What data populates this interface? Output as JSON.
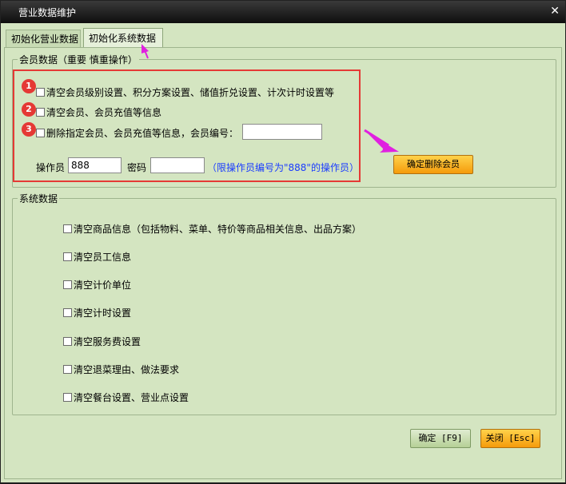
{
  "window": {
    "title": "营业数据维护"
  },
  "tabs": [
    {
      "label": "初始化营业数据"
    },
    {
      "label": "初始化系统数据"
    }
  ],
  "member_group": {
    "legend": "会员数据（重要  慎重操作）",
    "badges": [
      "1",
      "2",
      "3"
    ],
    "options": [
      {
        "label": "清空会员级别设置、积分方案设置、储值折兑设置、计次计时设置等"
      },
      {
        "label": "清空会员、会员充值等信息"
      },
      {
        "label": "删除指定会员、会员充值等信息，会员编号："
      }
    ],
    "member_no_value": "",
    "operator_label": "操作员",
    "operator_value": "888",
    "password_label": "密码",
    "password_value": "",
    "hint": "（限操作员编号为\"888\"的操作员）",
    "confirm_delete_button": "确定删除会员"
  },
  "system_group": {
    "legend": "系统数据",
    "options": [
      {
        "label": "清空商品信息（包括物料、菜单、特价等商品相关信息、出品方案）"
      },
      {
        "label": "清空员工信息"
      },
      {
        "label": "清空计价单位"
      },
      {
        "label": "清空计时设置"
      },
      {
        "label": "清空服务费设置"
      },
      {
        "label": "清空退菜理由、做法要求"
      },
      {
        "label": "清空餐台设置、营业点设置"
      }
    ]
  },
  "footer": {
    "ok_button": "确定 [F9]",
    "close_button": "关闭 [Esc]"
  },
  "colors": {
    "annotation_red": "#e53935",
    "annotation_arrow": "#e020e0",
    "hint_blue": "#1a3cff"
  }
}
